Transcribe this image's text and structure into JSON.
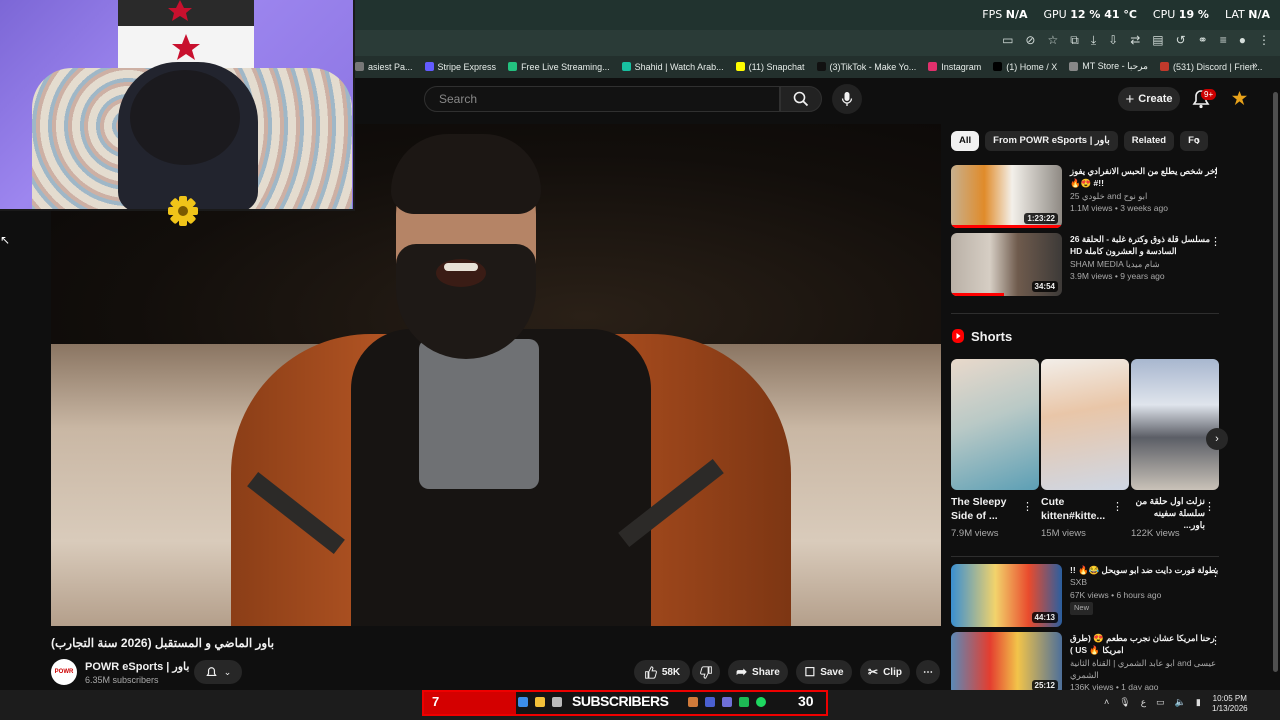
{
  "perf": {
    "fps_label": "FPS",
    "fps_value": "N/A",
    "gpu_label": "GPU",
    "gpu_value": "12 % 41 °C",
    "cpu_label": "CPU",
    "cpu_value": "19 %",
    "lat_label": "LAT",
    "lat_value": "N/A"
  },
  "bookmarks": [
    {
      "label": "asiest Pa...",
      "color": "#777777"
    },
    {
      "label": "Stripe Express",
      "color": "#635bff"
    },
    {
      "label": "Free Live Streaming...",
      "color": "#23c17f"
    },
    {
      "label": "Shahid | Watch Arab...",
      "color": "#18c0a0"
    },
    {
      "label": "(11) Snapchat",
      "color": "#fffc00"
    },
    {
      "label": "(3)TikTok - Make Yo...",
      "color": "#111111"
    },
    {
      "label": "Instagram",
      "color": "#e1306c"
    },
    {
      "label": "(1) Home / X",
      "color": "#000000"
    },
    {
      "label": "MT Store - مرحبا",
      "color": "#888888"
    },
    {
      "label": "(531) Discord | Frien...",
      "color": "#c0392b"
    }
  ],
  "header": {
    "search_placeholder": "Search",
    "create_label": "Create",
    "notif_count": "9+"
  },
  "video": {
    "title": "باور الماضي و المستقبل (2026 سنة التجارب)",
    "channel": "POWR eSports | باور",
    "subscribers": "6.35M subscribers",
    "likes": "58K",
    "share": "Share",
    "save": "Save",
    "clip": "Clip"
  },
  "chips": [
    "All",
    "From POWR eSports | باور",
    "Related",
    "Fo"
  ],
  "recs_top": [
    {
      "title": "اخر شخص يطلع من الحبس الانفرادي يفوز !!# 😍🔥",
      "channel": "25 خلودي and ابو نوح",
      "stats": "1.1M views • 3 weeks ago",
      "duration": "1:23:22"
    },
    {
      "title": "مسلسل قلة ذوق وكترة غلبة - الحلقة 26 السادسة و العشرون كاملة HD",
      "channel": "SHAM MEDIA شام ميديا",
      "stats": "3.9M views • 9 years ago",
      "duration": "34:54"
    }
  ],
  "shorts": {
    "heading": "Shorts",
    "items": [
      {
        "title": "The Sleepy Side of ...",
        "views": "7.9M views"
      },
      {
        "title": "Cute kitten#kitte...",
        "views": "15M views"
      },
      {
        "title": "نزلت اول حلقة من سلسلة سفينه باور...",
        "views": "122K views"
      }
    ]
  },
  "recs_bottom": [
    {
      "title": "بطولة فورت دايت ضد ابو سويحل 😂🔥 !!",
      "channel": "SXB",
      "stats": "67K views • 6 hours ago",
      "badge": "New",
      "duration": "44:13"
    },
    {
      "title": "رحنا امريكا عشان نجرب مطعم 😍 (طرق امريكا 🔥 US )",
      "channel": "ابو عابد الشمري | القناة الثانية and عيسى الشمري",
      "stats": "136K views • 1 day ago",
      "duration": "25:12"
    }
  ],
  "taskbar": {
    "sub_left": "7",
    "sub_label": "SUBSCRIBERS",
    "sub_right": "30",
    "lang": "ع",
    "time": "10:05 PM",
    "date": "1/13/2026"
  }
}
